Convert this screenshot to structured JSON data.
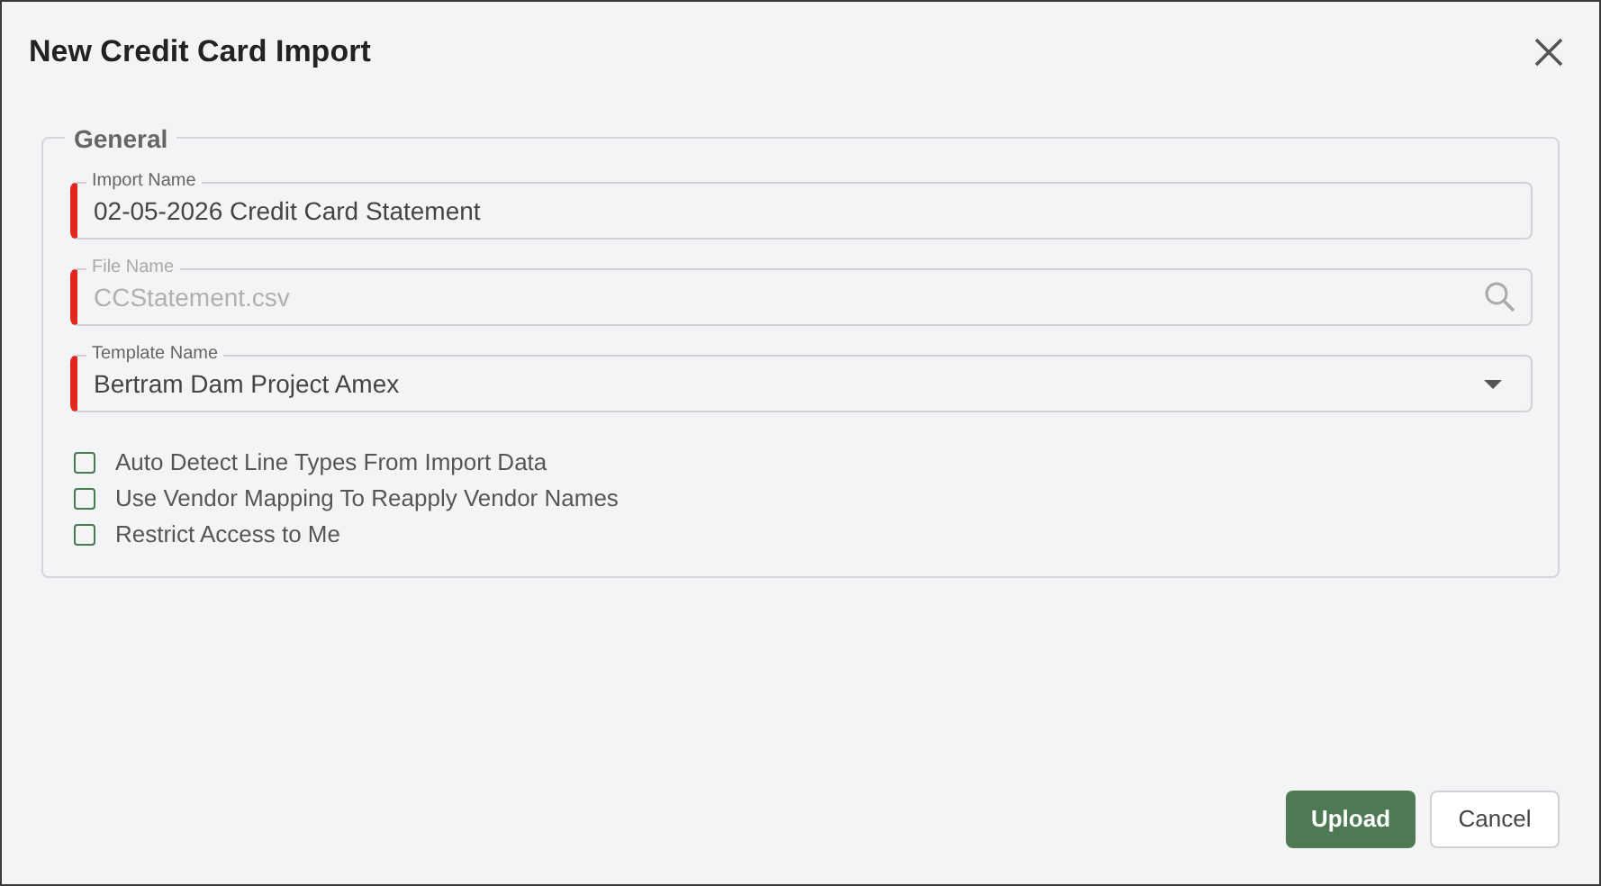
{
  "dialog": {
    "title": "New Credit Card Import"
  },
  "group": {
    "legend": "General",
    "fields": [
      {
        "kind": "text",
        "label": "Import Name",
        "value": "02-05-2026 Credit Card Statement",
        "required": true,
        "disabled": false
      },
      {
        "kind": "search",
        "label": "File Name",
        "value": "CCStatement.csv",
        "required": true,
        "disabled": true
      },
      {
        "kind": "select",
        "label": "Template Name",
        "value": "Bertram Dam Project Amex",
        "required": true,
        "disabled": false
      }
    ],
    "options": [
      {
        "label": "Auto Detect Line Types From Import Data",
        "checked": false
      },
      {
        "label": "Use Vendor Mapping To Reapply Vendor Names",
        "checked": false
      },
      {
        "label": "Restrict Access to Me",
        "checked": false
      }
    ]
  },
  "buttons": [
    {
      "label": "Upload",
      "kind": "primary"
    },
    {
      "label": "Cancel",
      "kind": "secondary"
    }
  ]
}
